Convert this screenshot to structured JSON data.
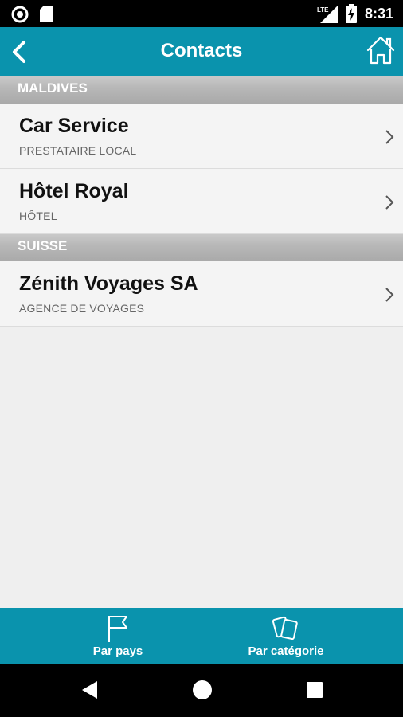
{
  "status_bar": {
    "time": "8:31",
    "network": "LTE",
    "icons": [
      "circle-notification-icon",
      "sd-card-icon",
      "signal-icon",
      "battery-charging-icon"
    ]
  },
  "header": {
    "title": "Contacts",
    "back_icon": "chevron-left-icon",
    "home_icon": "home-icon"
  },
  "sections": [
    {
      "title": "MALDIVES",
      "items": [
        {
          "name": "Car Service",
          "category": "PRESTATAIRE LOCAL"
        },
        {
          "name": "Hôtel Royal",
          "category": "HÔTEL"
        }
      ]
    },
    {
      "title": "SUISSE",
      "items": [
        {
          "name": "Zénith Voyages SA",
          "category": "AGENCE DE VOYAGES"
        }
      ]
    }
  ],
  "tabs": [
    {
      "label": "Par pays",
      "icon": "flag-icon"
    },
    {
      "label": "Par catégorie",
      "icon": "cards-icon"
    }
  ],
  "nav": [
    "back-triangle-icon",
    "home-circle-icon",
    "recents-square-icon"
  ],
  "colors": {
    "accent": "#0a93ad",
    "section_header": "#b8b8b8",
    "row_background": "#f4f4f4",
    "page_background": "#efefef"
  }
}
